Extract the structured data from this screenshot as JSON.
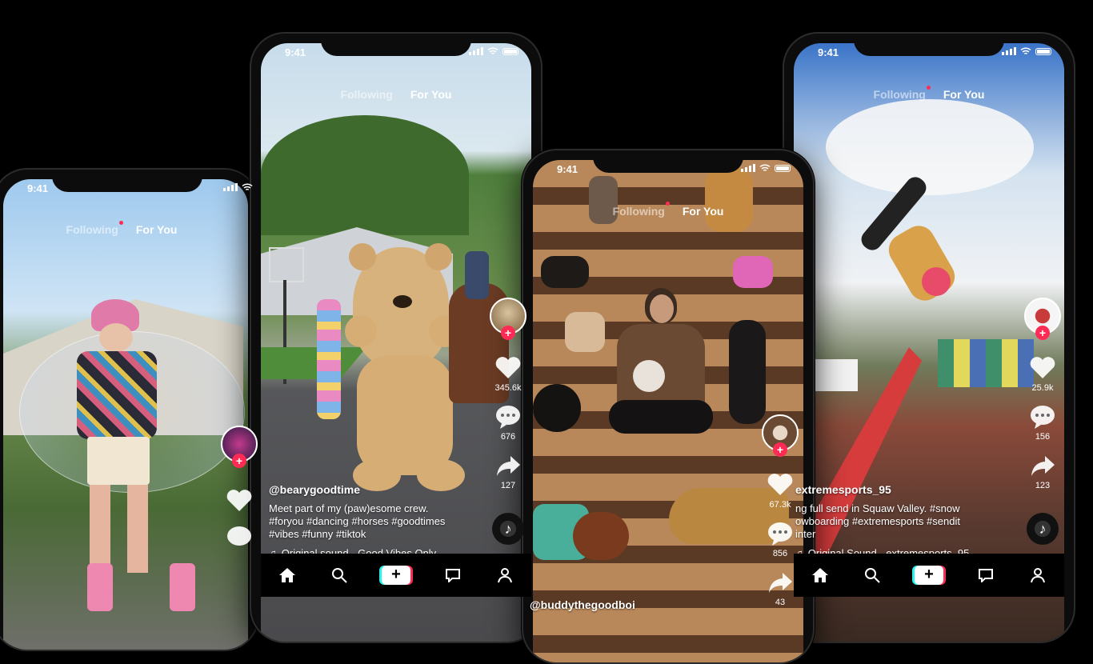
{
  "status": {
    "time": "9:41"
  },
  "tabs": {
    "following": "Following",
    "for_you": "For You"
  },
  "phones": [
    {
      "counts": {
        "likes": "",
        "comments": "",
        "shares": ""
      }
    },
    {
      "counts": {
        "likes": "345.6k",
        "comments": "676",
        "shares": "127"
      },
      "caption": {
        "user": "@bearygoodtime",
        "line1": "Meet part of my (paw)esome crew.",
        "line2": "#foryou #dancing #horses #goodtimes",
        "line3": "#vibes #funny #tiktok",
        "sound": "Original sound - Good Vibes Only"
      }
    },
    {
      "counts": {
        "likes": "67.3k",
        "comments": "856",
        "shares": "43"
      },
      "caption": {
        "user": "@buddythegoodboi"
      }
    },
    {
      "counts": {
        "likes": "25.9k",
        "comments": "156",
        "shares": "123"
      },
      "caption": {
        "user": "extremesports_95",
        "line1": "ng full send in Squaw Valley. #snow",
        "line2": "owboarding #extremesports #sendit",
        "line3": "inter",
        "sound": "Original Sound - extremesports_95"
      }
    }
  ],
  "icons": {
    "home": "home-icon",
    "search": "search-icon",
    "create": "create-icon",
    "inbox": "inbox-icon",
    "profile": "profile-icon",
    "heart": "heart-icon",
    "comment": "comment-icon",
    "share": "share-icon",
    "music": "music-note-icon"
  },
  "colors": {
    "accent": "#fe2c55",
    "cyan": "#25f4ee",
    "background": "#000000"
  }
}
